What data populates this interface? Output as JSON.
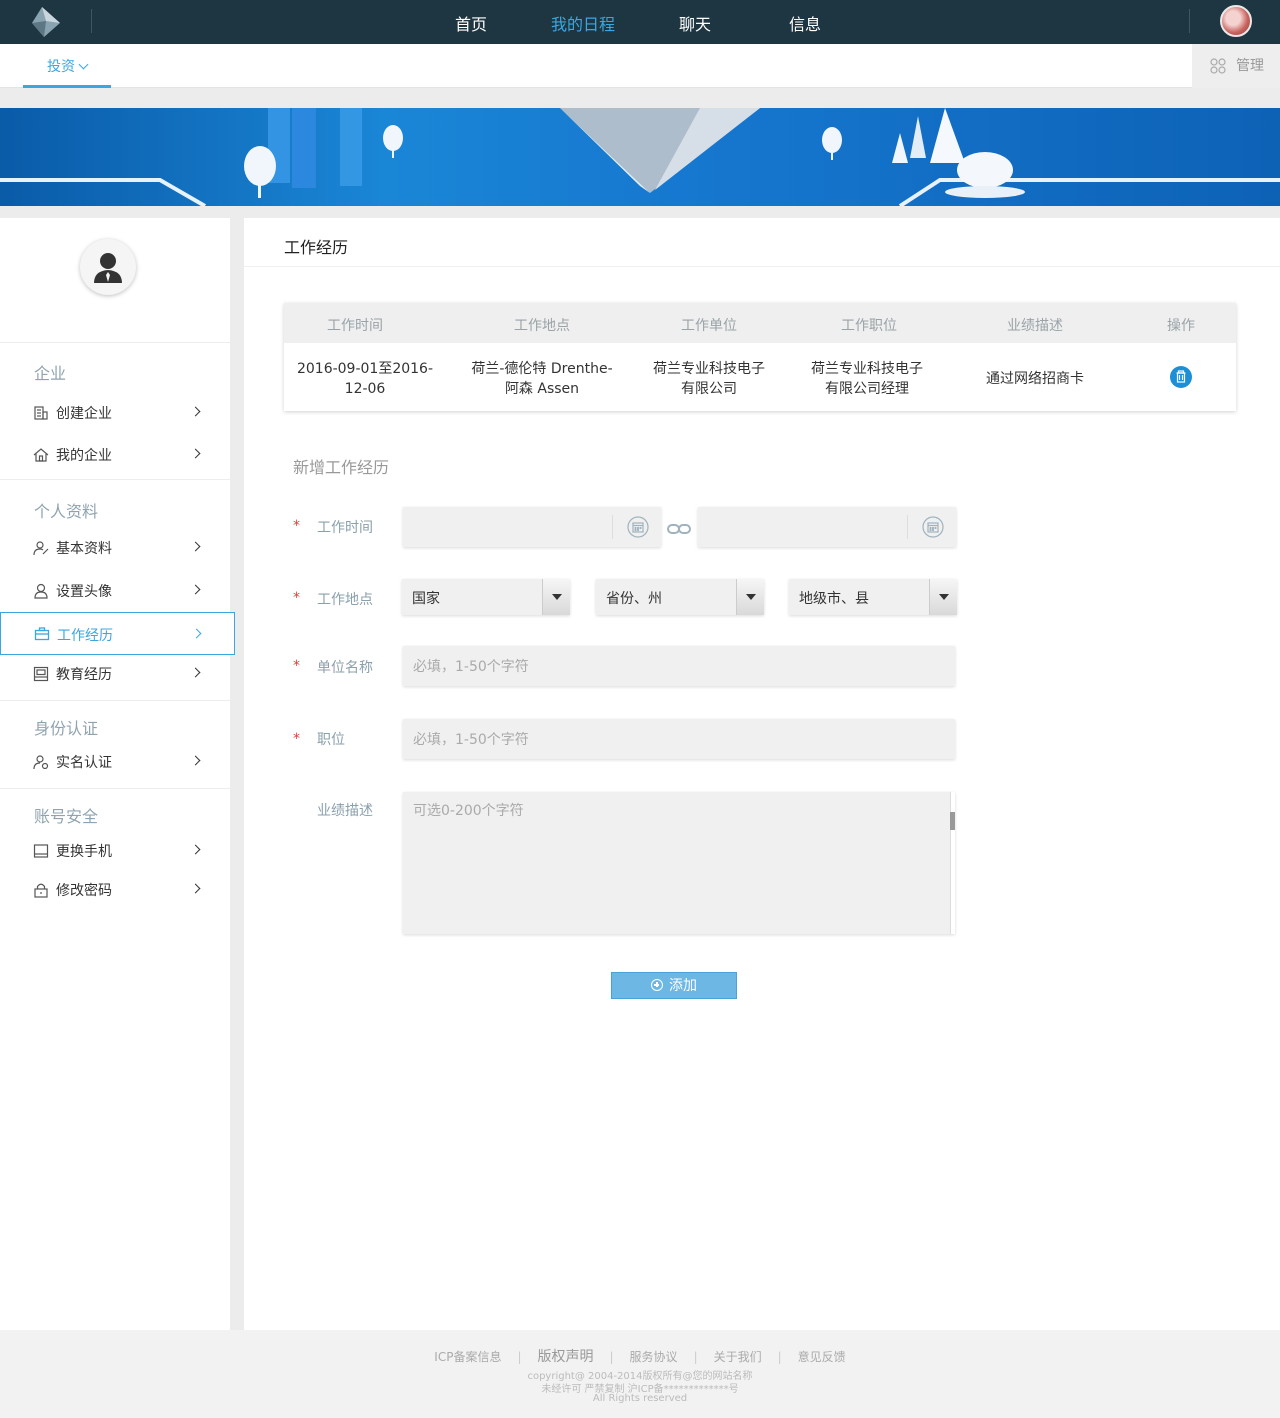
{
  "topnav": {
    "items": [
      {
        "label": "首页",
        "active": false
      },
      {
        "label": "我的日程",
        "active": true
      },
      {
        "label": "聊天",
        "active": false
      },
      {
        "label": "信息",
        "active": false
      }
    ]
  },
  "subnav": {
    "tab_label": "投资",
    "manage_label": "管理"
  },
  "sidebar": {
    "sections": [
      {
        "heading": "企业",
        "items": [
          {
            "label": "创建企业",
            "icon": "building-icon"
          },
          {
            "label": "我的企业",
            "icon": "home-icon"
          }
        ]
      },
      {
        "heading": "个人资料",
        "items": [
          {
            "label": "基本资料",
            "icon": "user-edit-icon"
          },
          {
            "label": "设置头像",
            "icon": "user-icon"
          },
          {
            "label": "工作经历",
            "icon": "briefcase-icon",
            "active": true
          },
          {
            "label": "教育经历",
            "icon": "book-icon"
          }
        ]
      },
      {
        "heading": "身份认证",
        "items": [
          {
            "label": "实名认证",
            "icon": "id-user-icon"
          }
        ]
      },
      {
        "heading": "账号安全",
        "items": [
          {
            "label": "更换手机",
            "icon": "phone-icon"
          },
          {
            "label": "修改密码",
            "icon": "lock-icon"
          }
        ]
      }
    ]
  },
  "main": {
    "title": "工作经历",
    "table": {
      "headers": [
        "工作时间",
        "工作地点",
        "工作单位",
        "工作职位",
        "业绩描述",
        "操作"
      ],
      "rows": [
        {
          "time": [
            "2016-09-01至2016-",
            "12-06"
          ],
          "place": [
            "荷兰-德伦特 Drenthe-",
            "阿森 Assen"
          ],
          "company": [
            "荷兰专业科技电子",
            "有限公司"
          ],
          "position": [
            "荷兰专业科技电子",
            "有限公司经理"
          ],
          "description": "通过网络招商卡",
          "action_icon": "trash-icon"
        }
      ]
    },
    "form": {
      "title": "新增工作经历",
      "required_mark": "*",
      "labels": {
        "time": "工作时间",
        "place": "工作地点",
        "company": "单位名称",
        "position": "职位",
        "description": "业绩描述"
      },
      "selects": {
        "country": "国家",
        "province": "省份、州",
        "city": "地级市、县"
      },
      "placeholders": {
        "company": "必填，1-50个字符",
        "position": "必填，1-50个字符",
        "description": "可选0-200个字符"
      },
      "add_button": "添加"
    }
  },
  "footer": {
    "links": [
      "ICP备案信息",
      "版权声明",
      "服务协议",
      "关于我们",
      "意见反馈"
    ],
    "separator": "|",
    "copyright": "copyright@ 2004-2014版权所有@您的网站名称",
    "license": "未经许可 严禁复制 沪ICP备*************号",
    "rights": "All Rights reserved"
  },
  "colors": {
    "topbar": "#1e3642",
    "accent": "#3ba7e0",
    "required": "#e23b3b",
    "add_button": "#6db7e4"
  }
}
